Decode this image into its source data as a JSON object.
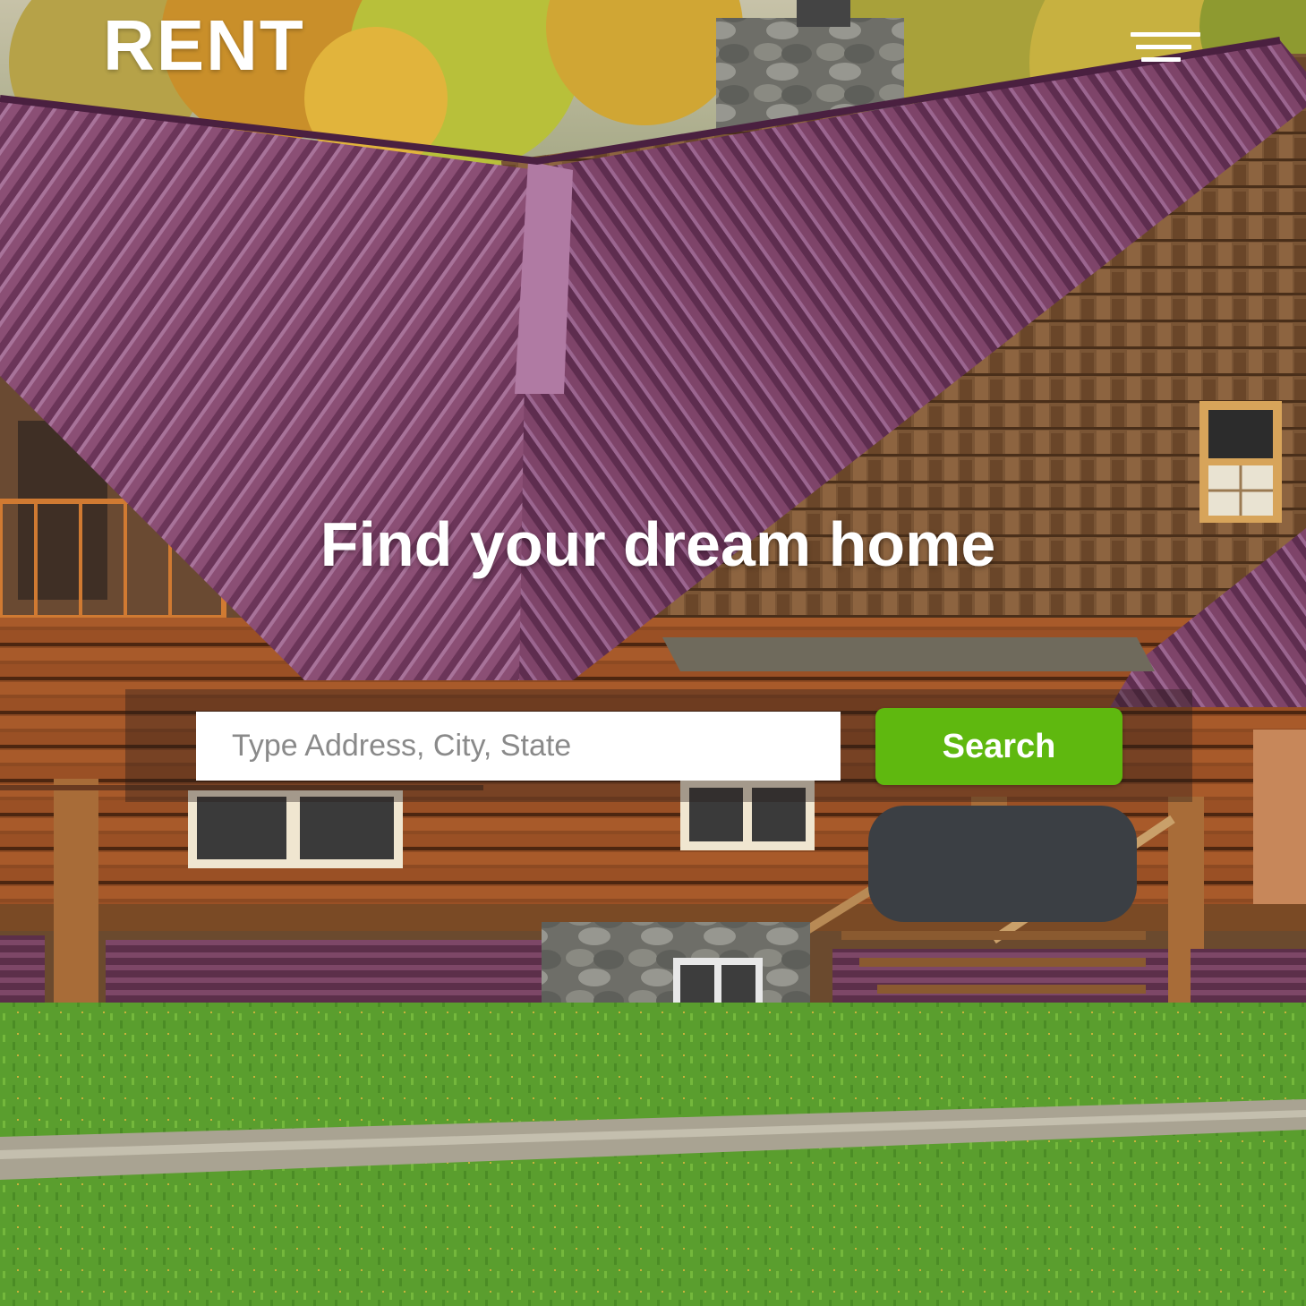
{
  "header": {
    "logo_text": "RENT",
    "menu_icon": "hamburger-menu-icon"
  },
  "hero": {
    "headline": "Find your dream home",
    "background_image": "log-cabin-house-with-purple-metal-roof-autumn-trees-green-lawn"
  },
  "search": {
    "placeholder": "Type Address, City, State",
    "value": "",
    "button_label": "Search"
  },
  "colors": {
    "accent": "#5fb80f",
    "text_on_image": "#ffffff",
    "roof": "#7a3a63",
    "logs": "#8a4a24",
    "lawn": "#5aa02c"
  }
}
